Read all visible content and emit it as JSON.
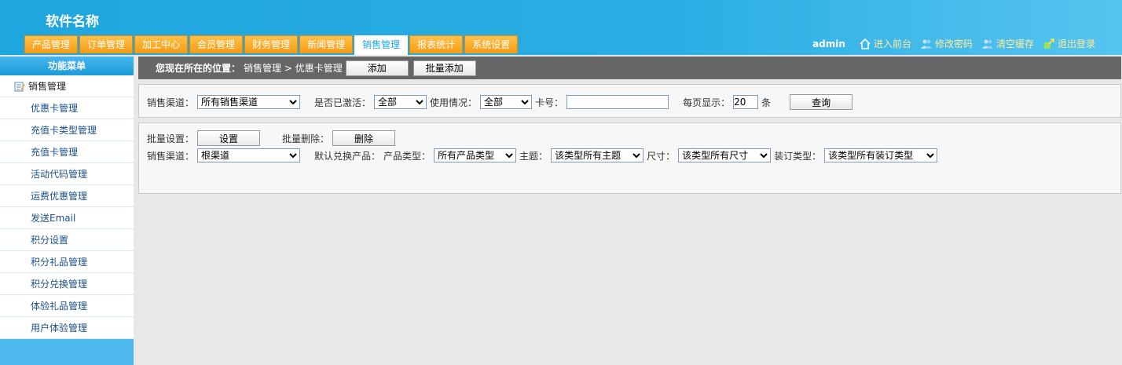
{
  "header": {
    "app_title": "软件名称"
  },
  "nav": {
    "tabs": [
      "产品管理",
      "订单管理",
      "加工中心",
      "会员管理",
      "财务管理",
      "新闻管理",
      "销售管理",
      "报表统计",
      "系统设置"
    ],
    "active": 6
  },
  "toplinks": {
    "user": "admin",
    "front": "进入前台",
    "password": "修改密码",
    "cache": "清空缓存",
    "logout": "退出登录"
  },
  "sidebar": {
    "title": "功能菜单",
    "category": "销售管理",
    "items": [
      "优惠卡管理",
      "充值卡类型管理",
      "充值卡管理",
      "活动代码管理",
      "运费优惠管理",
      "发送Email",
      "积分设置",
      "积分礼品管理",
      "积分兑换管理",
      "体验礼品管理",
      "用户体验管理"
    ]
  },
  "breadcrumb": {
    "prefix": "您现在所在的位置：",
    "path": "销售管理 > 优惠卡管理",
    "add": "添加",
    "batch_add": "批量添加"
  },
  "filter": {
    "channel_label": "销售渠道：",
    "channel_value": "所有销售渠道",
    "active_label": "是否已激活：",
    "active_value": "全部",
    "usage_label": "使用情况：",
    "usage_value": "全部",
    "card_label": "卡号：",
    "card_value": "",
    "perpage_label": "每页显示：",
    "perpage_value": "20",
    "perpage_unit": "条",
    "query": "查询"
  },
  "batch": {
    "setting_label": "批量设置：",
    "setting_btn": "设置",
    "delete_label": "批量删除：",
    "delete_btn": "删除",
    "channel_label": "销售渠道：",
    "channel_value": "根渠道",
    "exchange_label": "默认兑换产品：",
    "ptype_label": "产品类型：",
    "ptype_value": "所有产品类型",
    "theme_label": "主题：",
    "theme_value": "该类型所有主题",
    "size_label": "尺寸：",
    "size_value": "该类型所有尺寸",
    "binding_label": "装订类型：",
    "binding_value": "该类型所有装订类型"
  }
}
